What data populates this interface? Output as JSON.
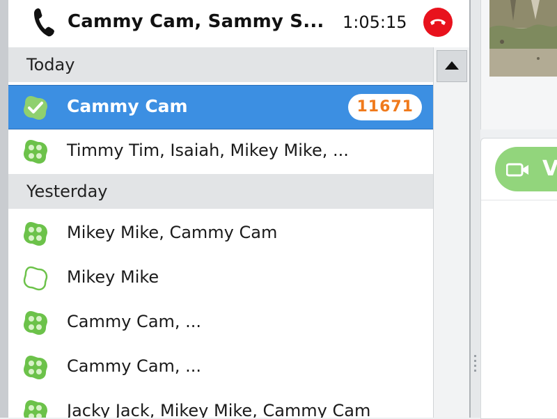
{
  "call": {
    "title": "Cammy Cam, Sammy S...",
    "duration": "1:05:15"
  },
  "sections": [
    {
      "label": "Today",
      "items": [
        {
          "label": "Cammy Cam",
          "badge": "11671",
          "selected": true,
          "icon": "online-check-icon"
        },
        {
          "label": "Timmy Tim, Isaiah, Mikey Mike, ...",
          "icon": "group-chat-icon"
        }
      ]
    },
    {
      "label": "Yesterday",
      "items": [
        {
          "label": "Mikey Mike, Cammy Cam",
          "icon": "group-chat-icon"
        },
        {
          "label": "Mikey Mike",
          "icon": "offline-contact-icon"
        },
        {
          "label": "Cammy Cam, ...",
          "icon": "group-chat-icon"
        },
        {
          "label": "Cammy Cam, ...",
          "icon": "group-chat-icon"
        },
        {
          "label": "Jacky Jack, Mikey Mike, Cammy Cam",
          "icon": "group-chat-icon"
        }
      ]
    }
  ],
  "right_pane": {
    "video_button_label": "V"
  },
  "colors": {
    "selected_row": "#3c8fe2",
    "badge_text": "#f07a1c",
    "hangup": "#e8121d",
    "skype_green": "#6cc24a",
    "video_button": "#92d57c"
  }
}
